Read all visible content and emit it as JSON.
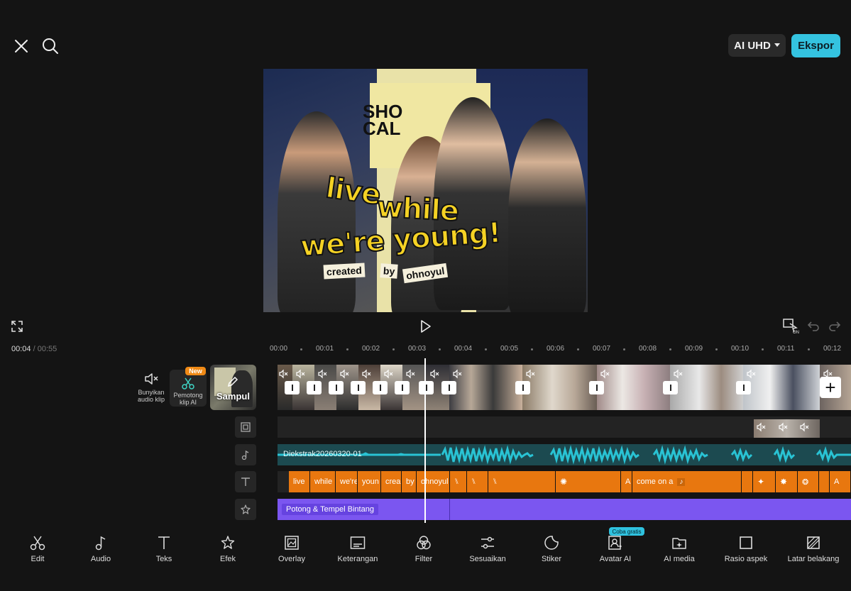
{
  "topbar": {
    "quality_label": "AI UHD",
    "export_label": "Ekspor"
  },
  "preview": {
    "sign_text": "SHO\nCAL",
    "caption_line1": "live",
    "caption_line2": "while",
    "caption_line3": "we're young!",
    "tag_created": "created",
    "tag_by": "by",
    "tag_author": "ohnoyul"
  },
  "timeline": {
    "current_time": "00:04",
    "separator": "/",
    "total_time": "00:55",
    "ruler": [
      "00:00",
      "00:01",
      "00:02",
      "00:03",
      "00:04",
      "00:05",
      "00:06",
      "00:07",
      "00:08",
      "00:09",
      "00:10",
      "00:11",
      "00:12"
    ],
    "mute_label": "Bunyikan audio klip",
    "cutter_label": "Pemotong klip AI",
    "new_badge": "New",
    "cover_label": "Sampul",
    "audio_track_name": "Diekstrak20260320-01",
    "text_clips": [
      "live",
      "while",
      "we're",
      "youn",
      "crea",
      "by",
      "ohnoyul",
      "",
      "",
      "",
      "",
      "A",
      "come on a",
      "",
      "",
      "",
      "",
      "",
      "A"
    ],
    "effect_label": "Potong & Tempel Bintang"
  },
  "toolbar": {
    "items": [
      "Edit",
      "Audio",
      "Teks",
      "Efek",
      "Overlay",
      "Keterangan",
      "Filter",
      "Sesuaikan",
      "Stiker",
      "Avatar AI",
      "AI media",
      "Rasio aspek",
      "Latar belakang"
    ],
    "try_badge": "Coba gratis"
  },
  "colors": {
    "background": "#141414",
    "accent": "#34c3e0",
    "text_clip": "#e8770f",
    "effect_clip": "#7b56f0",
    "audio_clip": "#1c4a50"
  }
}
